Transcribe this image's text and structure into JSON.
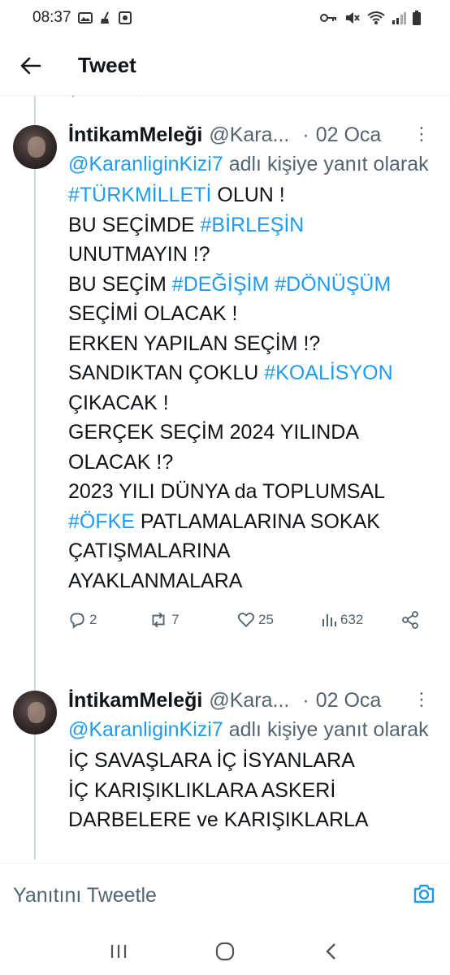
{
  "status_bar": {
    "time": "08:37",
    "left_icons": [
      "image-icon",
      "broom-icon",
      "square-notification-icon"
    ],
    "right_icons": [
      "key-icon",
      "mute-icon",
      "wifi-icon",
      "signal-icon",
      "battery-icon"
    ]
  },
  "header": {
    "title": "Tweet",
    "back_icon": "arrow-left-icon"
  },
  "tweets": [
    {
      "name": "İntikamMeleği",
      "handle": "@Kara...",
      "dot": "·",
      "date": "02 Oca",
      "more": "⋮",
      "reply_prefix": "@KaranliginKizi7",
      "reply_suffix": " adlı kişiye yanıt olarak",
      "lines": [
        [
          {
            "t": "#TÜRKMİLLETİ",
            "tag": true
          },
          {
            "t": " OLUN !"
          }
        ],
        [
          {
            "t": "BU SEÇİMDE "
          },
          {
            "t": "#BİRLEŞİN",
            "tag": true
          }
        ],
        [
          {
            "t": "UNUTMAYIN !?"
          }
        ],
        [
          {
            "t": "BU SEÇİM "
          },
          {
            "t": "#DEĞİŞİM",
            "tag": true
          },
          {
            "t": " "
          },
          {
            "t": "#DÖNÜŞÜM",
            "tag": true
          }
        ],
        [
          {
            "t": "SEÇİMİ OLACAK !"
          }
        ],
        [
          {
            "t": "ERKEN YAPILAN SEÇİM !?"
          }
        ],
        [
          {
            "t": "SANDIKTAN ÇOKLU "
          },
          {
            "t": "#KOALİSYON",
            "tag": true
          }
        ],
        [
          {
            "t": "ÇIKACAK !"
          }
        ],
        [
          {
            "t": "GERÇEK SEÇİM 2024 YILINDA"
          }
        ],
        [
          {
            "t": "OLACAK !?"
          }
        ],
        [
          {
            "t": "2023 YILI DÜNYA da TOPLUMSAL"
          }
        ],
        [
          {
            "t": "#ÖFKE",
            "tag": true
          },
          {
            "t": " PATLAMALARINA SOKAK"
          }
        ],
        [
          {
            "t": "ÇATIŞMALARINA"
          }
        ],
        [
          {
            "t": "AYAKLANMALARA"
          }
        ]
      ],
      "actions": {
        "replies": "2",
        "retweets": "7",
        "likes": "25",
        "views": "632"
      }
    },
    {
      "name": "İntikamMeleği",
      "handle": "@Kara...",
      "dot": "·",
      "date": "02 Oca",
      "more": "⋮",
      "reply_prefix": "@KaranliginKizi7",
      "reply_suffix": " adlı kişiye yanıt olarak",
      "lines": [
        [
          {
            "t": "İÇ SAVAŞLARA İÇ İSYANLARA"
          }
        ],
        [
          {
            "t": "İÇ KARIŞIKLIKLARA ASKERİ"
          }
        ],
        [
          {
            "t": "DARBELERE ve KARIŞIKLARLA"
          }
        ]
      ]
    }
  ],
  "compose": {
    "placeholder": "Yanıtını Tweetle",
    "camera_icon": "camera-icon"
  },
  "nav_bar": {
    "buttons": [
      "recent-apps-icon",
      "home-circle-icon",
      "back-chevron-icon"
    ]
  },
  "colors": {
    "accent": "#1d9bf0",
    "text": "#0f1419",
    "secondary": "#536471",
    "divider": "#eff3f4"
  }
}
